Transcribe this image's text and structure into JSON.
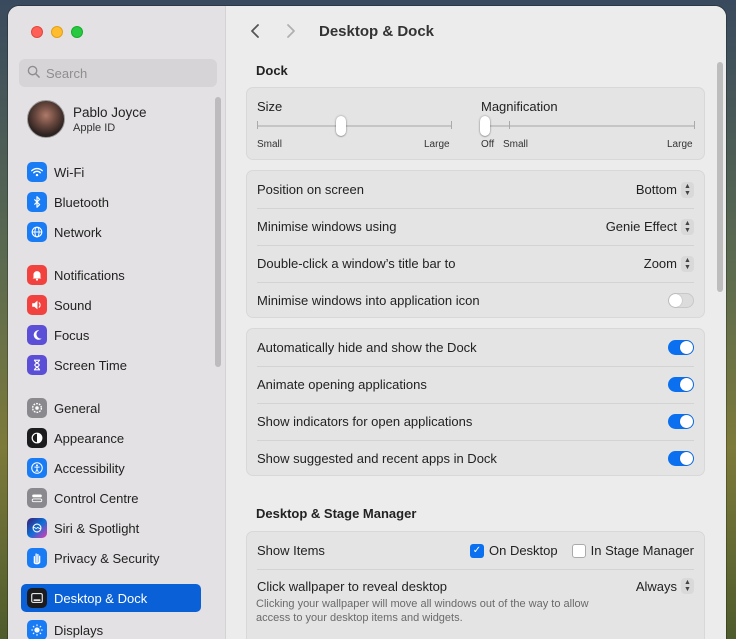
{
  "window": {
    "title": "Desktop & Dock"
  },
  "search": {
    "placeholder": "Search"
  },
  "profile": {
    "name": "Pablo Joyce",
    "subtitle": "Apple ID"
  },
  "sidebar": {
    "items": [
      {
        "label": "Wi-Fi",
        "icon": "wifi-icon",
        "color": "#1a7cf5"
      },
      {
        "label": "Bluetooth",
        "icon": "bluetooth-icon",
        "color": "#1a7cf5"
      },
      {
        "label": "Network",
        "icon": "globe-icon",
        "color": "#1a7cf5"
      },
      {
        "label": "Notifications",
        "icon": "bell-icon",
        "color": "#f2423f"
      },
      {
        "label": "Sound",
        "icon": "speaker-icon",
        "color": "#f2423f"
      },
      {
        "label": "Focus",
        "icon": "moon-icon",
        "color": "#5a4fd6"
      },
      {
        "label": "Screen Time",
        "icon": "hourglass-icon",
        "color": "#5a4fd6"
      },
      {
        "label": "General",
        "icon": "gear-icon",
        "color": "#8a8a8e"
      },
      {
        "label": "Appearance",
        "icon": "appearance-icon",
        "color": "#1c1c1e"
      },
      {
        "label": "Accessibility",
        "icon": "accessibility-icon",
        "color": "#1a7cf5"
      },
      {
        "label": "Control Centre",
        "icon": "control-centre-icon",
        "color": "#8a8a8e"
      },
      {
        "label": "Siri & Spotlight",
        "icon": "siri-icon",
        "color": "#2b2b8a"
      },
      {
        "label": "Privacy & Security",
        "icon": "hand-icon",
        "color": "#1a7cf5"
      },
      {
        "label": "Desktop & Dock",
        "icon": "dock-icon",
        "color": "#1c1c1e"
      },
      {
        "label": "Displays",
        "icon": "sun-icon",
        "color": "#1a7cf5"
      }
    ],
    "active": "Desktop & Dock"
  },
  "dock": {
    "section_title": "Dock",
    "size": {
      "label": "Size",
      "min_label": "Small",
      "max_label": "Large",
      "value": 0.43
    },
    "magnification": {
      "label": "Magnification",
      "off_label": "Off",
      "min_label": "Small",
      "max_label": "Large",
      "value": 0.0
    },
    "settings": [
      {
        "label": "Position on screen",
        "value": "Bottom"
      },
      {
        "label": "Minimise windows using",
        "value": "Genie Effect"
      },
      {
        "label": "Double-click a window’s title bar to",
        "value": "Zoom"
      },
      {
        "label": "Minimise windows into application icon",
        "toggle": false
      }
    ],
    "toggles": [
      {
        "label": "Automatically hide and show the Dock",
        "on": true
      },
      {
        "label": "Animate opening applications",
        "on": true
      },
      {
        "label": "Show indicators for open applications",
        "on": true
      },
      {
        "label": "Show suggested and recent apps in Dock",
        "on": true
      }
    ]
  },
  "stage": {
    "section_title": "Desktop & Stage Manager",
    "show_items": {
      "label": "Show Items",
      "on_desktop": {
        "label": "On Desktop",
        "checked": true
      },
      "in_stage_manager": {
        "label": "In Stage Manager",
        "checked": false
      }
    },
    "click_wallpaper": {
      "label": "Click wallpaper to reveal desktop",
      "value": "Always",
      "description": "Clicking your wallpaper will move all windows out of the way to allow access to your desktop items and widgets."
    }
  }
}
